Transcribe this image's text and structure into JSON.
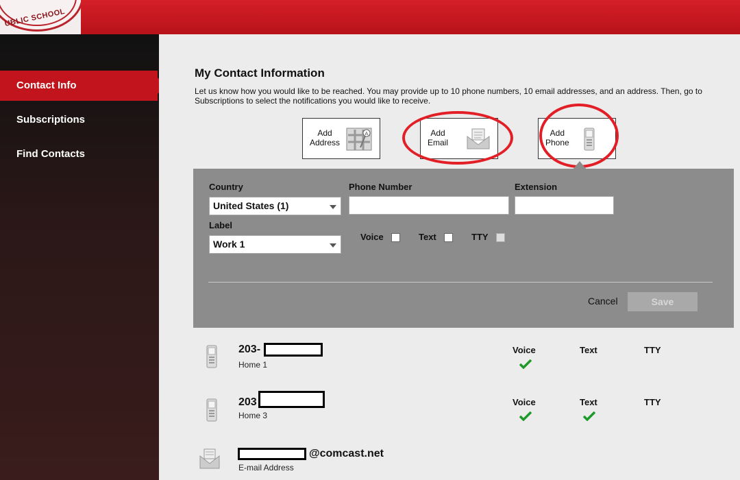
{
  "logo": {
    "text": "UBLIC SCHOOL"
  },
  "sidebar": {
    "items": [
      {
        "label": "Contact Info"
      },
      {
        "label": "Subscriptions"
      },
      {
        "label": "Find Contacts"
      }
    ]
  },
  "main": {
    "title": "My Contact Information",
    "description": "Let us know how you would like to be reached. You may provide up to 10 phone numbers, 10 email addresses, and an address. Then, go to Subscriptions to select the notifications you would like to receive.",
    "add_buttons": [
      {
        "line1": "Add",
        "line2": "Address"
      },
      {
        "line1": "Add",
        "line2": "Email"
      },
      {
        "line1": "Add",
        "line2": "Phone"
      }
    ]
  },
  "form": {
    "country_label": "Country",
    "country_value": "United States (1)",
    "phone_label": "Phone Number",
    "phone_value": "",
    "extension_label": "Extension",
    "extension_value": "",
    "label_label": "Label",
    "label_value": "Work 1",
    "voice_label": "Voice",
    "text_label": "Text",
    "tty_label": "TTY",
    "cancel_label": "Cancel",
    "save_label": "Save"
  },
  "contacts": {
    "headers": {
      "voice": "Voice",
      "text": "Text",
      "tty": "TTY"
    },
    "items": [
      {
        "number": "203-",
        "label": "Home 1",
        "voice": true,
        "text": false,
        "tty": false
      },
      {
        "number": "203",
        "label": "Home 3",
        "voice": true,
        "text": true,
        "tty": false
      },
      {
        "email_suffix": "@comcast.net",
        "label": "E-mail Address"
      }
    ]
  },
  "colors": {
    "brand_red": "#c1141c",
    "check_green": "#1e9a2a",
    "highlight_circle": "#e21e26"
  }
}
